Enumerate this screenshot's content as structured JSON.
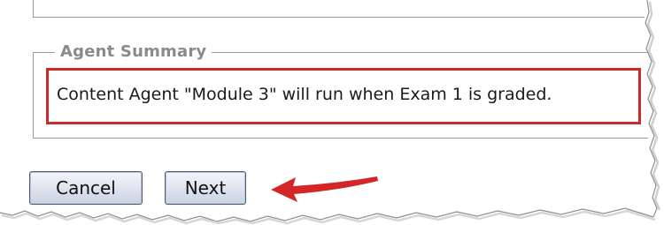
{
  "summary": {
    "legend": "Agent Summary",
    "text": "Content Agent \"Module 3\" will run when Exam 1 is graded."
  },
  "actions": {
    "cancel_label": "Cancel",
    "next_label": "Next"
  },
  "colors": {
    "highlight": "#cc2a2a",
    "arrow": "#d42626"
  }
}
